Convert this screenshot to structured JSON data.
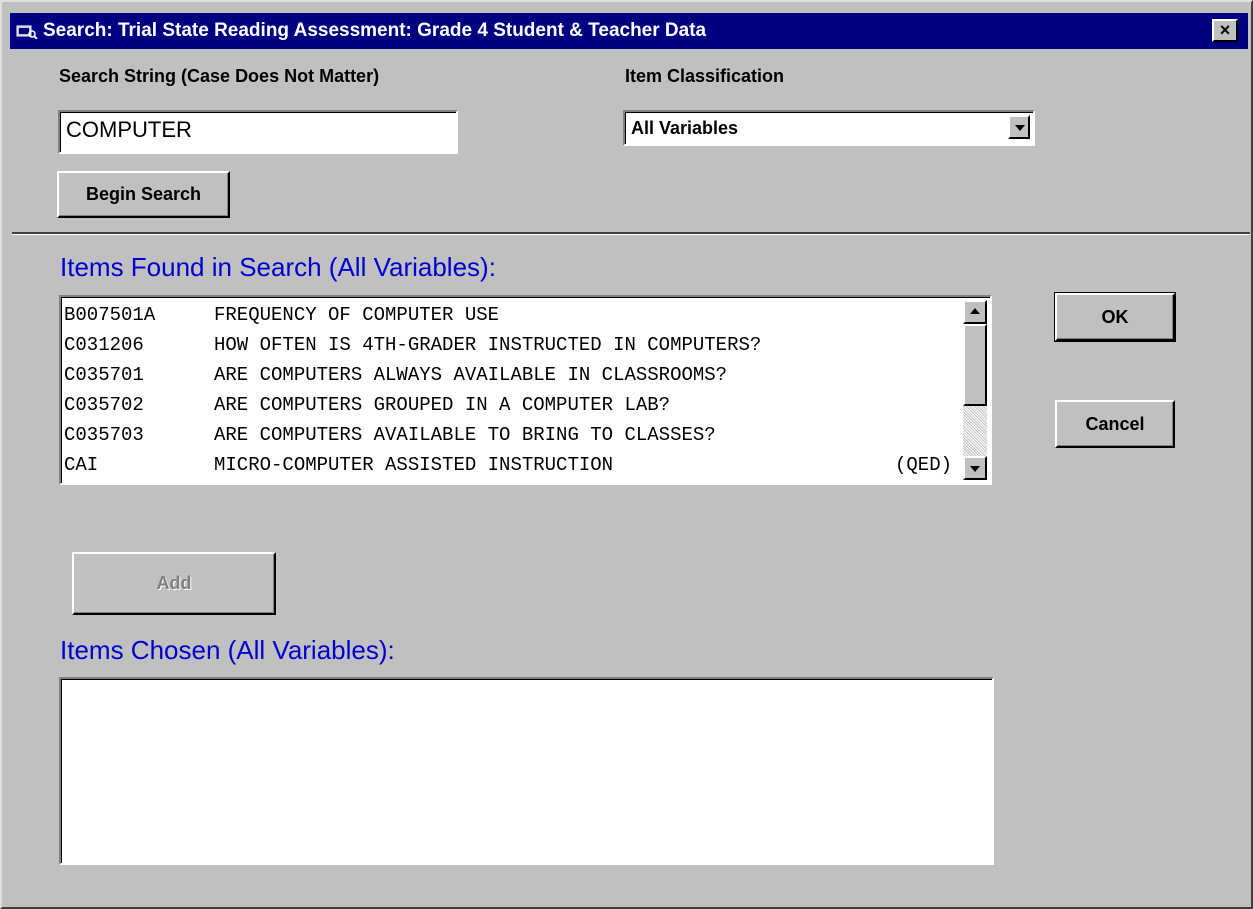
{
  "window": {
    "title": "Search: Trial State Reading Assessment: Grade 4 Student & Teacher Data",
    "close_label": "×"
  },
  "search": {
    "label": "Search String (Case Does Not Matter)",
    "value": "COMPUTER",
    "begin_label": "Begin Search"
  },
  "classification": {
    "label": "Item Classification",
    "selected": "All Variables"
  },
  "found": {
    "label": "Items Found in Search (All Variables):",
    "items": [
      {
        "code": "B007501A",
        "desc": "FREQUENCY OF COMPUTER USE",
        "suffix": ""
      },
      {
        "code": "C031206",
        "desc": "HOW OFTEN IS 4TH-GRADER INSTRUCTED IN COMPUTERS?",
        "suffix": ""
      },
      {
        "code": "C035701",
        "desc": "ARE COMPUTERS ALWAYS AVAILABLE IN CLASSROOMS?",
        "suffix": ""
      },
      {
        "code": "C035702",
        "desc": "ARE COMPUTERS GROUPED IN A COMPUTER LAB?",
        "suffix": ""
      },
      {
        "code": "C035703",
        "desc": "ARE COMPUTERS AVAILABLE TO BRING TO CLASSES?",
        "suffix": ""
      },
      {
        "code": "CAI",
        "desc": "MICRO-COMPUTER ASSISTED INSTRUCTION",
        "suffix": "(QED)"
      }
    ]
  },
  "buttons": {
    "ok": "OK",
    "cancel": "Cancel",
    "add": "Add"
  },
  "chosen": {
    "label": "Items Chosen (All Variables):"
  },
  "colors": {
    "titlebar": "#000080",
    "label_blue": "#0000d0",
    "face": "#c0c0c0"
  }
}
